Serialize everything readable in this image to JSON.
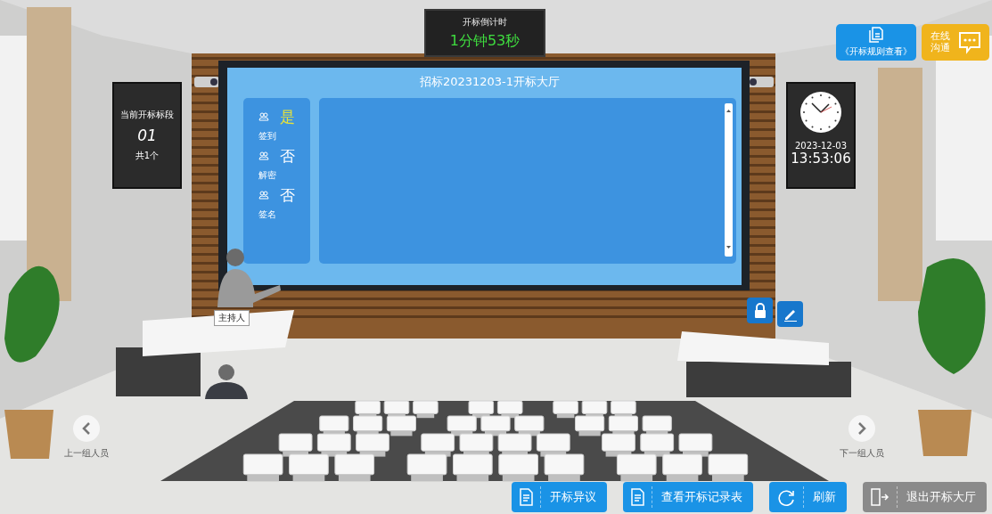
{
  "countdown": {
    "label": "开标倒计时",
    "value": "1分钟53秒"
  },
  "hall_title": "招标20231203-1开标大厅",
  "status_items": [
    {
      "label": "签到",
      "value": "是",
      "done": true
    },
    {
      "label": "解密",
      "value": "否",
      "done": false
    },
    {
      "label": "签名",
      "value": "否",
      "done": false
    }
  ],
  "section_board": {
    "heading": "当前开标标段",
    "number": "01",
    "total": "共1个"
  },
  "clock": {
    "date": "2023-12-03",
    "time": "13:53:06"
  },
  "top_buttons": [
    {
      "kind": "rules",
      "label": "《开标规则查看》"
    },
    {
      "kind": "chat",
      "label": "在线沟通"
    }
  ],
  "host_label": "主持人",
  "nav": {
    "previous": "上一组人员",
    "next": "下一组人员"
  },
  "bottom_buttons": [
    {
      "kind": "document",
      "label": "开标异议"
    },
    {
      "kind": "document",
      "label": "查看开标记录表"
    },
    {
      "kind": "refresh",
      "label": "刷新"
    },
    {
      "kind": "exit",
      "label": "退出开标大厅"
    }
  ]
}
